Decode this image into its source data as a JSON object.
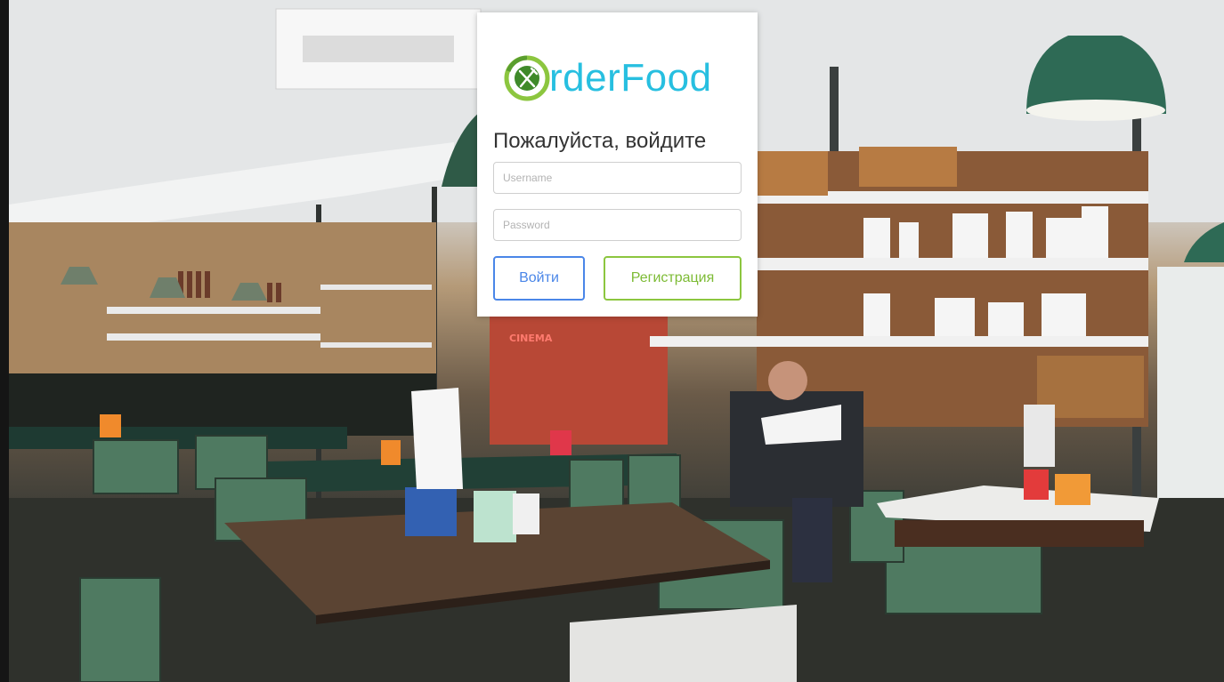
{
  "brand": {
    "name": "rderFood",
    "logo_icon": "fork-knife-circle-icon",
    "logo_ring_color": "#8cc63f",
    "logo_text_color": "#27bfe0"
  },
  "login": {
    "heading": "Пожалуйста, войдите",
    "username_placeholder": "Username",
    "password_placeholder": "Password",
    "login_label": "Войти",
    "register_label": "Регистрация"
  },
  "background": {
    "sign_text": "CINEMA",
    "sign_color": "#e8463c"
  },
  "colors": {
    "login_button": "#4a86e8",
    "register_button": "#8cc63f"
  }
}
